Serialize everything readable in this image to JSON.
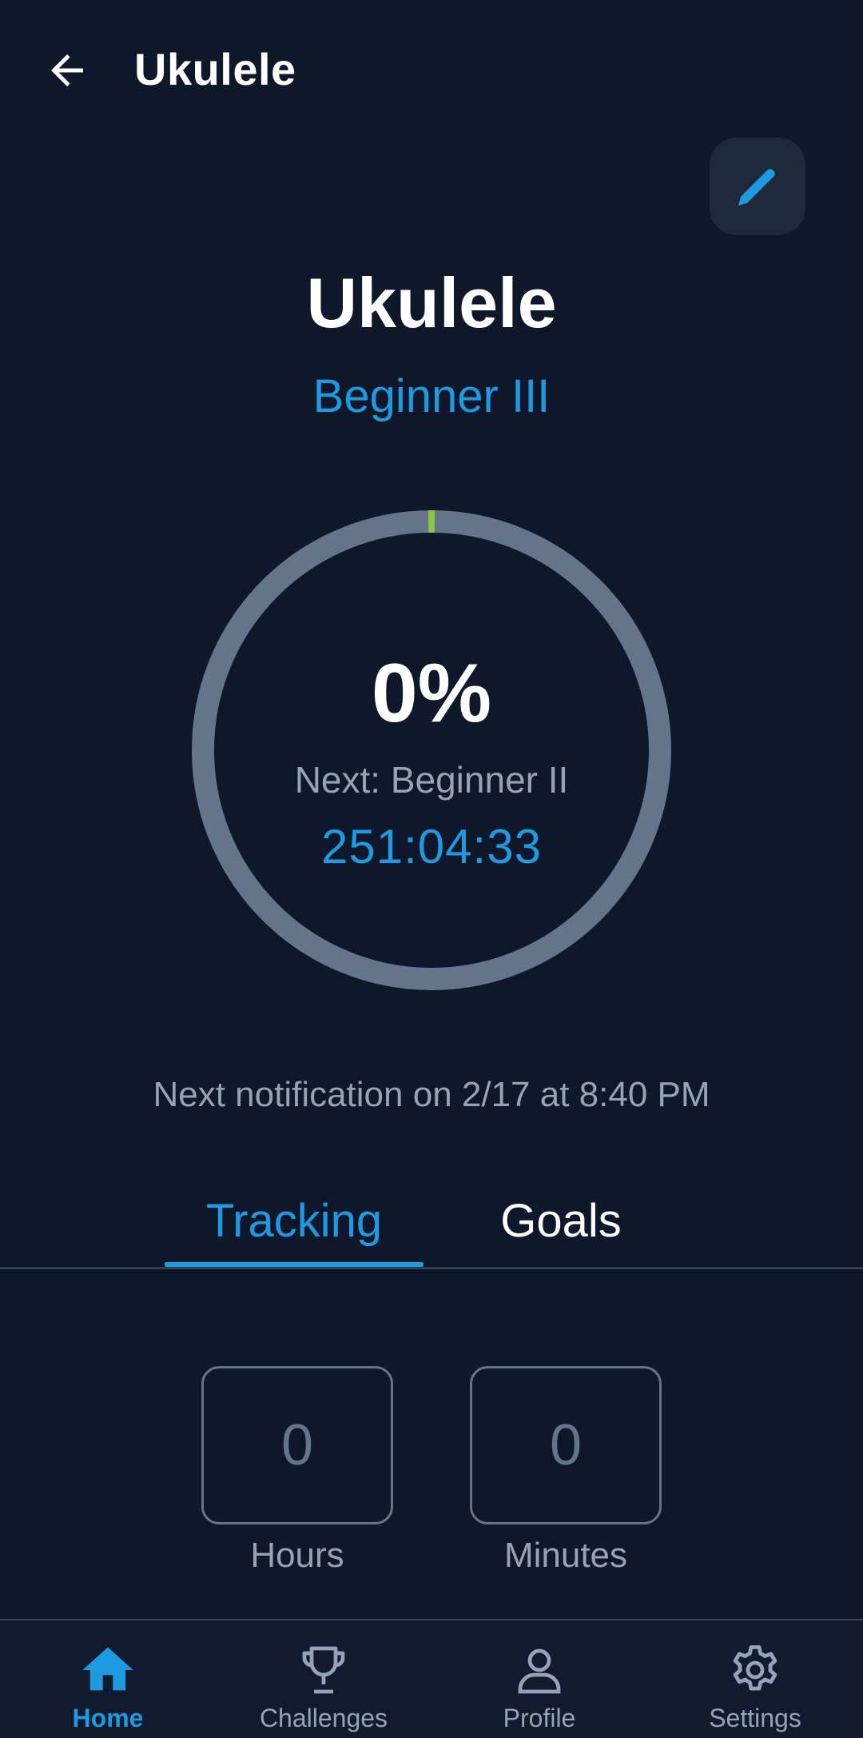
{
  "appbar": {
    "title": "Ukulele"
  },
  "header": {
    "instrument": "Ukulele",
    "level": "Beginner III"
  },
  "progress": {
    "percent_label": "0%",
    "percent_value": 0,
    "next_label": "Next: Beginner II",
    "timer": "251:04:33"
  },
  "notification": "Next notification on 2/17 at 8:40 PM",
  "tabs": [
    {
      "label": "Tracking",
      "active": true
    },
    {
      "label": "Goals",
      "active": false
    }
  ],
  "tracking": {
    "hours_value": "0",
    "hours_label": "Hours",
    "minutes_value": "0",
    "minutes_label": "Minutes"
  },
  "bottom_nav": [
    {
      "label": "Home",
      "icon": "home-icon",
      "active": true
    },
    {
      "label": "Challenges",
      "icon": "trophy-icon",
      "active": false
    },
    {
      "label": "Profile",
      "icon": "person-icon",
      "active": false
    },
    {
      "label": "Settings",
      "icon": "gear-icon",
      "active": false
    }
  ],
  "colors": {
    "background": "#0f172a",
    "accent": "#1e9be0",
    "ring_track": "#64748b",
    "ring_progress": "#8dc63f",
    "muted_text": "#94a3b8",
    "surface": "#1e293b"
  }
}
